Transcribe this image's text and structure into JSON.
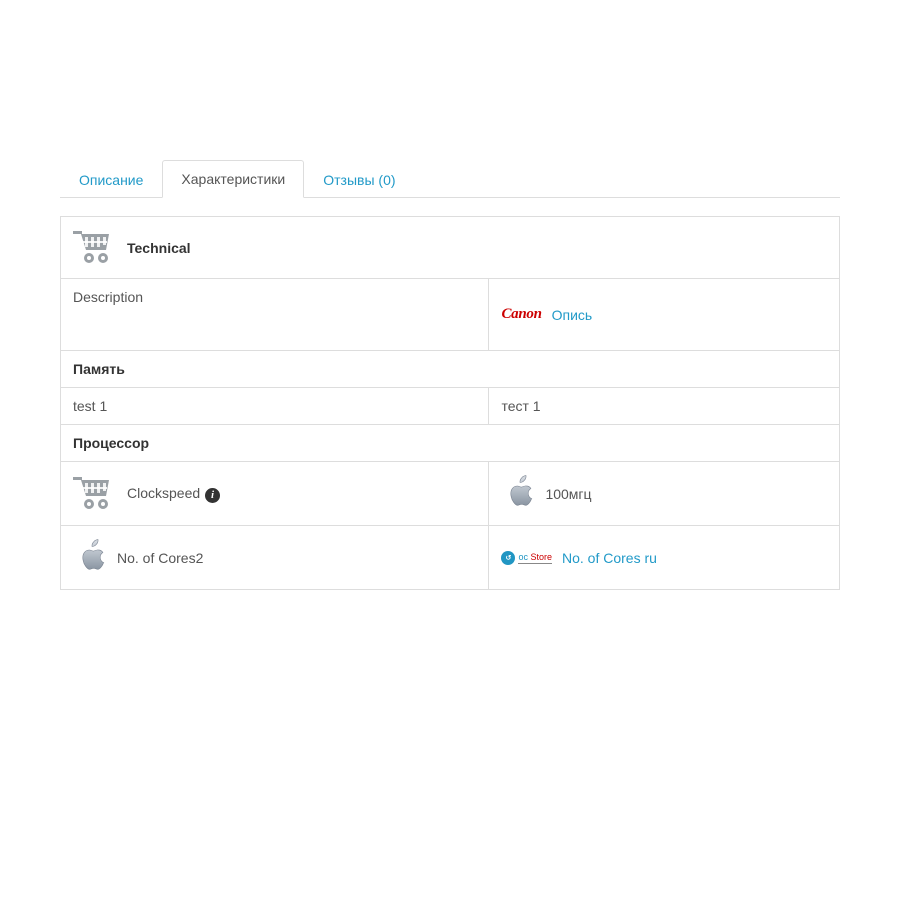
{
  "tabs": {
    "description": "Описание",
    "specs": "Характеристики",
    "reviews": "Отзывы (0)"
  },
  "sections": {
    "technical": {
      "title": "Technical",
      "rows": {
        "description": {
          "label": "Description",
          "brand": "Canon",
          "link": "Опись"
        }
      }
    },
    "memory": {
      "title": "Память",
      "rows": {
        "test": {
          "left": "test 1",
          "right": "тест 1"
        }
      }
    },
    "processor": {
      "title": "Процессор",
      "rows": {
        "clockspeed": {
          "label": "Clockspeed",
          "value": "100мгц"
        },
        "cores": {
          "label": "No. of Cores2",
          "badge_oc": "oc",
          "badge_store": "Store",
          "link": "No. of Cores ru"
        }
      }
    }
  }
}
